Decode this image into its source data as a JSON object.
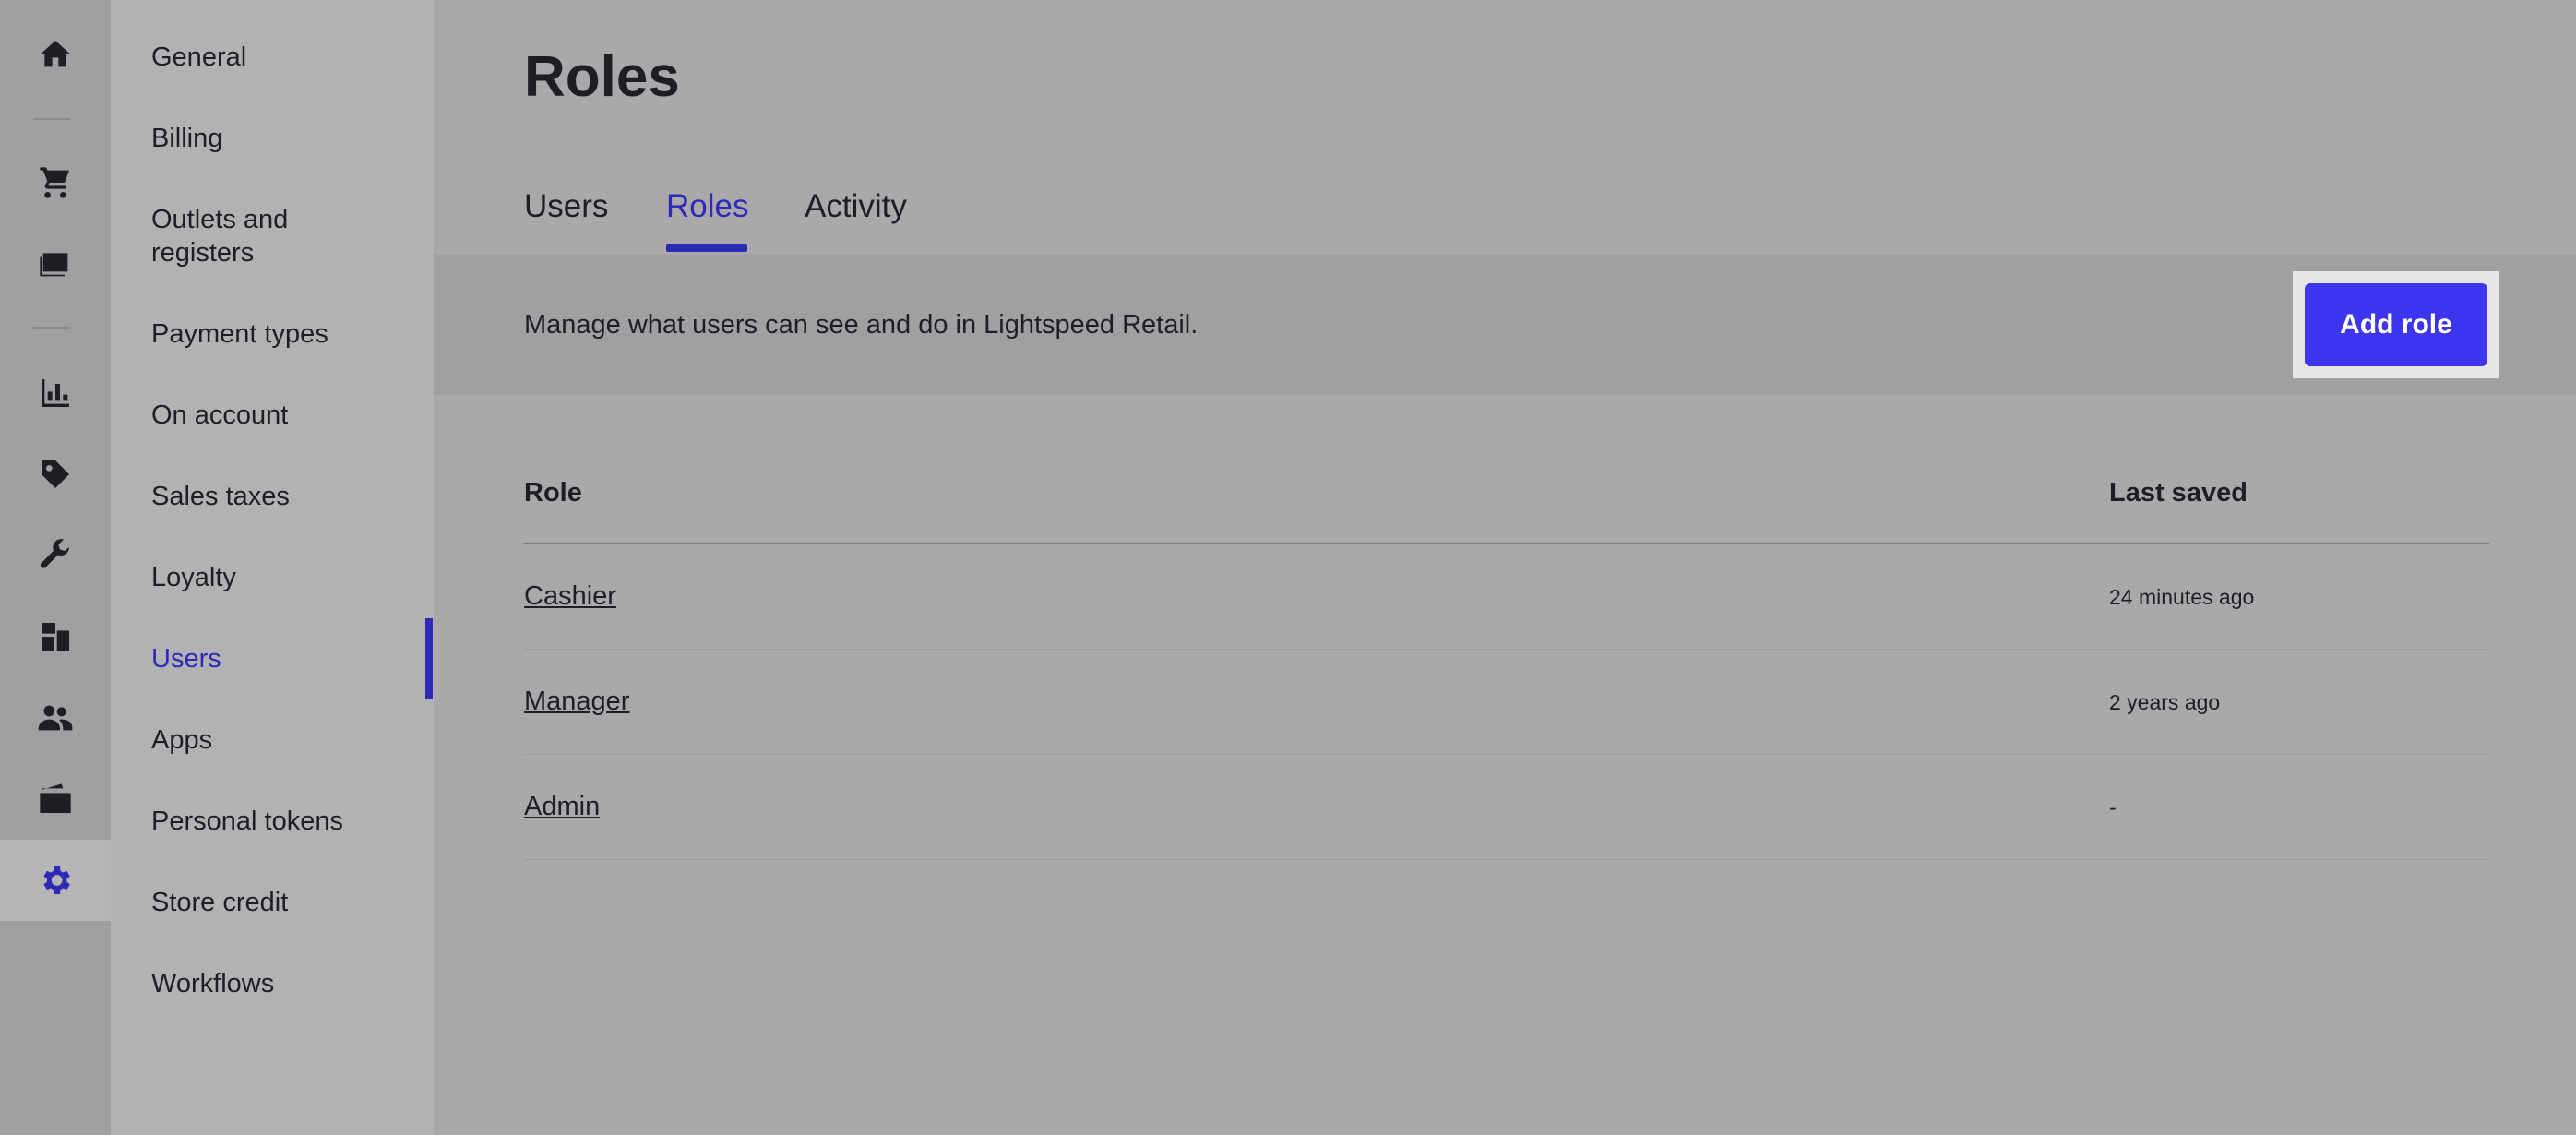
{
  "rail": {
    "items": [
      {
        "icon": "home-icon",
        "active": false
      },
      {
        "icon": "cart-icon",
        "active": false
      },
      {
        "icon": "register-icon",
        "active": false
      },
      {
        "icon": "chart-icon",
        "active": false
      },
      {
        "icon": "tag-icon",
        "active": false
      },
      {
        "icon": "wrench-icon",
        "active": false
      },
      {
        "icon": "boxes-icon",
        "active": false
      },
      {
        "icon": "customers-icon",
        "active": false
      },
      {
        "icon": "folder-icon",
        "active": false
      },
      {
        "icon": "gear-icon",
        "active": true
      }
    ],
    "accent_color": "#2d2bb5"
  },
  "subnav": {
    "items": [
      {
        "label": "General"
      },
      {
        "label": "Billing"
      },
      {
        "label": "Outlets and registers"
      },
      {
        "label": "Payment types"
      },
      {
        "label": "On account"
      },
      {
        "label": "Sales taxes"
      },
      {
        "label": "Loyalty"
      },
      {
        "label": "Users",
        "active": true
      },
      {
        "label": "Apps"
      },
      {
        "label": "Personal tokens"
      },
      {
        "label": "Store credit"
      },
      {
        "label": "Workflows"
      }
    ]
  },
  "main": {
    "title": "Roles",
    "tabs": [
      {
        "label": "Users"
      },
      {
        "label": "Roles",
        "active": true
      },
      {
        "label": "Activity"
      }
    ],
    "banner": {
      "text": "Manage what users can see and do in Lightspeed Retail.",
      "button_label": "Add role",
      "button_color": "#3d35f0"
    },
    "table": {
      "columns": [
        "Role",
        "Last saved"
      ],
      "rows": [
        {
          "role": "Cashier",
          "last_saved": "24 minutes ago"
        },
        {
          "role": "Manager",
          "last_saved": "2 years ago"
        },
        {
          "role": "Admin",
          "last_saved": "-"
        }
      ]
    }
  }
}
